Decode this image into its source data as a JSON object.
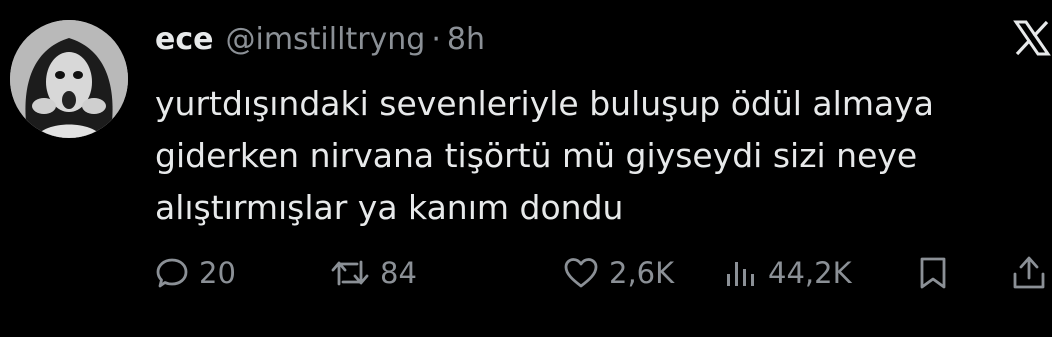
{
  "tweet": {
    "display_name": "ece",
    "handle": "@imstilltryng",
    "separator": "·",
    "time": "8h",
    "text": "yurtdışındaki sevenleriyle buluşup ödül almaya\ngiderken nirvana tişörtü mü giyseydi sizi neye\nalıştırmışlar ya kanım dondu"
  },
  "actions": {
    "reply": {
      "icon": "reply-icon",
      "count": "20"
    },
    "repost": {
      "icon": "repost-icon",
      "count": "84"
    },
    "like": {
      "icon": "heart-icon",
      "count": "2,6K"
    },
    "views": {
      "icon": "views-icon",
      "count": "44,2K"
    },
    "bookmark": {
      "icon": "bookmark-icon"
    },
    "share": {
      "icon": "share-icon"
    }
  },
  "colors": {
    "background": "#000000",
    "text": "#e7e9ea",
    "secondary": "#8b9096"
  }
}
